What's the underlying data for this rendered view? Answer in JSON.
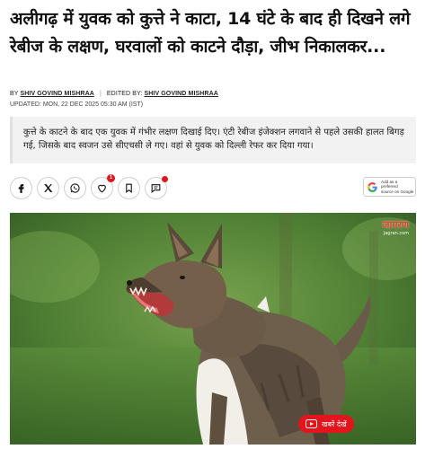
{
  "article": {
    "headline": "अलीगढ़ में युवक को कुत्ते ने काटा, 14 घंटे के बाद ही दिखने लगे रेबीज के लक्षण, घरवालों को काटने दौड़ा, जीभ निकालकर...",
    "byline": {
      "by_label": "BY",
      "author": "SHIV GOVIND MISHRAA",
      "edited_label": "EDITED BY:",
      "editor": "SHIV GOVIND MISHRAA"
    },
    "updated": "UPDATED: MON, 22 DEC 2025 05:30 AM (IST)",
    "summary": "कुत्ते के काटने के बाद एक युवक में गंभीर लक्षण दिखाई दिए। एंटी रेबीज इंजेक्शन लगवाने से पहले उसकी हालत बिगड़ गई, जिसके बाद स्वजन उसे सीएचसी ले गए। वहां से युवक को दिल्ली रेफर कर दिया गया।"
  },
  "share": {
    "buttons": [
      {
        "name": "facebook-share-button",
        "icon": "facebook-icon"
      },
      {
        "name": "x-share-button",
        "icon": "x-icon"
      },
      {
        "name": "whatsapp-share-button",
        "icon": "whatsapp-icon"
      },
      {
        "name": "like-button",
        "icon": "heart-icon",
        "badge": "1"
      },
      {
        "name": "bookmark-button",
        "icon": "bookmark-icon"
      },
      {
        "name": "comment-button",
        "icon": "comment-icon",
        "dot": true
      }
    ],
    "google_pref": {
      "line1": "Add as a preferred",
      "line2": "source on Google"
    }
  },
  "hero": {
    "watermark": "जागरण",
    "watermark_sub": "jagran.com",
    "video_label": "खबरें देखें"
  },
  "colors": {
    "accent": "#e2141c",
    "summary_bg": "#f2f2f2"
  }
}
